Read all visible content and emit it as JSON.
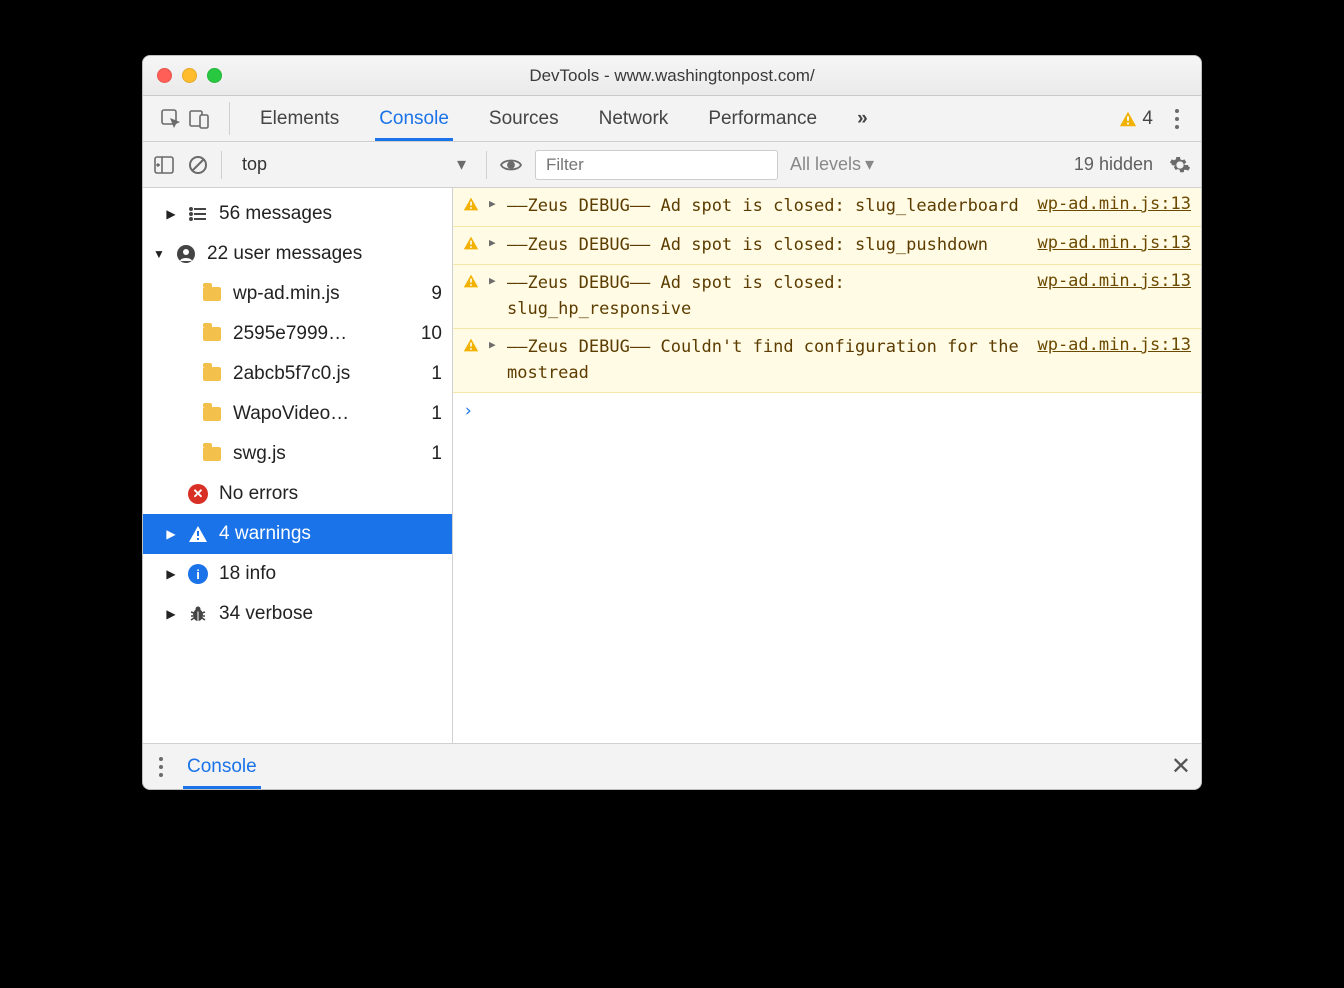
{
  "window_title": "DevTools - www.washingtonpost.com/",
  "tabs": {
    "elements": "Elements",
    "console": "Console",
    "sources": "Sources",
    "network": "Network",
    "performance": "Performance",
    "overflow": "»"
  },
  "top_warning_count": "4",
  "filter": {
    "context": "top",
    "placeholder": "Filter",
    "levels": "All levels",
    "hidden": "19 hidden"
  },
  "sidebar": {
    "messages": {
      "label": "56 messages"
    },
    "user_msgs": {
      "label": "22 user messages"
    },
    "files": [
      {
        "name": "wp-ad.min.js",
        "count": "9"
      },
      {
        "name": "2595e7999…",
        "count": "10"
      },
      {
        "name": "2abcb5f7c0.js",
        "count": "1"
      },
      {
        "name": "WapoVideo…",
        "count": "1"
      },
      {
        "name": "swg.js",
        "count": "1"
      }
    ],
    "errors": {
      "label": "No errors"
    },
    "warnings": {
      "label": "4 warnings"
    },
    "info": {
      "label": "18 info"
    },
    "verbose": {
      "label": "34 verbose"
    }
  },
  "messages": [
    {
      "text": "––Zeus DEBUG–– Ad spot is closed: slug_leaderboard",
      "source": "wp-ad.min.js:13"
    },
    {
      "text": "––Zeus DEBUG–– Ad spot is closed: slug_pushdown",
      "source": "wp-ad.min.js:13"
    },
    {
      "text": "––Zeus DEBUG–– Ad spot is closed: slug_hp_responsive",
      "source": "wp-ad.min.js:13"
    },
    {
      "text": "––Zeus DEBUG–– Couldn't find configuration for the mostread",
      "source": "wp-ad.min.js:13"
    }
  ],
  "prompt_symbol": "›",
  "drawer_tab": "Console"
}
